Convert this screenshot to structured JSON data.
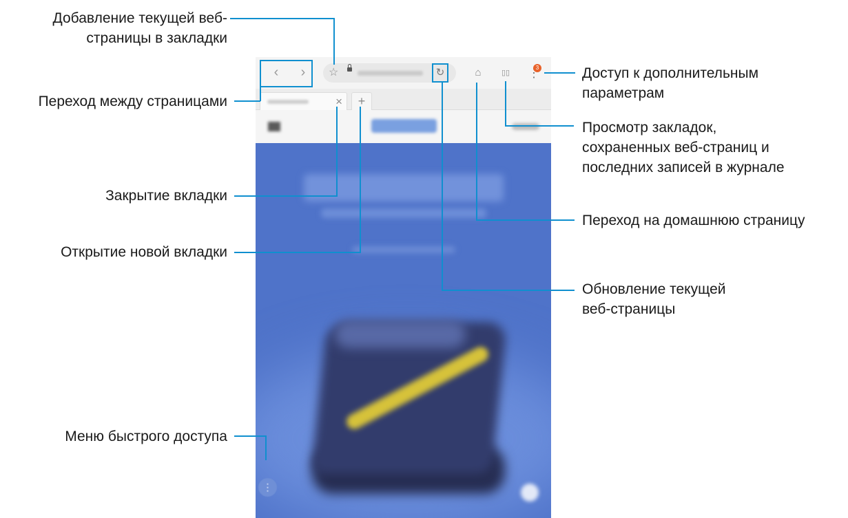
{
  "annotations": {
    "bookmark_add": "Добавление текущей веб-\nстраницы в закладки",
    "navigate_pages": "Переход между страницами",
    "close_tab": "Закрытие вкладки",
    "open_new_tab": "Открытие новой вкладки",
    "quick_access_menu": "Меню быстрого доступа",
    "more_options": "Доступ к дополнительным\nпараметрам",
    "view_bookmarks": "Просмотр закладок,\nсохраненных веб-страниц и\nпоследних записей в журнале",
    "home_page": "Переход на домашнюю страницу",
    "refresh_page": "Обновление текущей\nвеб-страницы"
  },
  "browser": {
    "back_icon": "‹",
    "forward_icon": "›",
    "star_icon": "☆",
    "reload_icon": "↻",
    "home_icon": "⌂",
    "bookmarks_icon": "▯▯",
    "more_icon": "⋮",
    "badge_count": "3",
    "tab_close_icon": "×",
    "new_tab_icon": "+",
    "fab_icon": "⋮"
  },
  "colors": {
    "callout_line": "#0f8fcf",
    "hero_blue": "#4f73c9",
    "badge": "#e8622a"
  }
}
